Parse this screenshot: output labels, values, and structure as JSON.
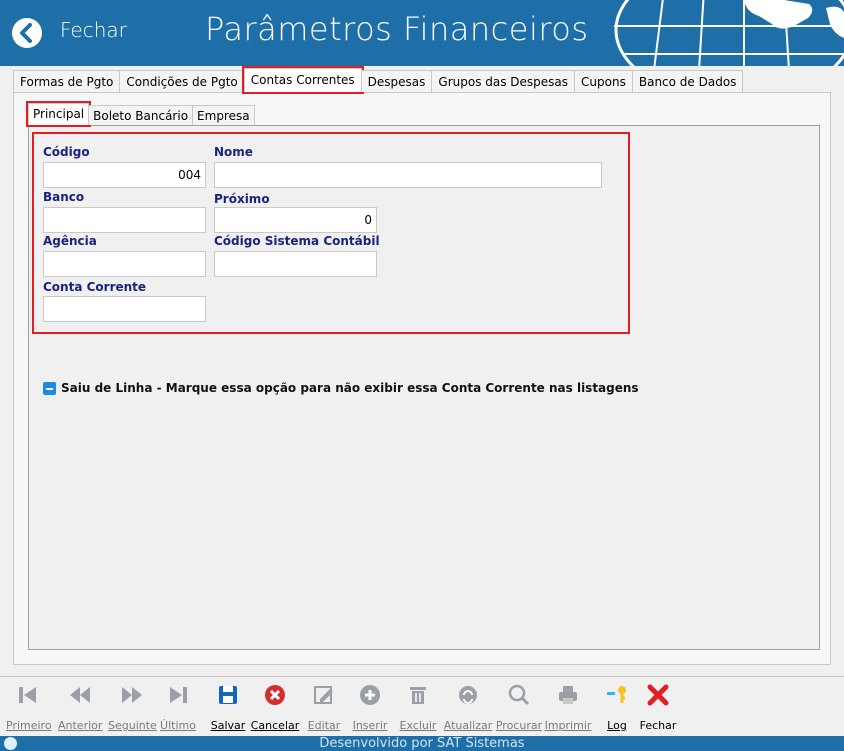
{
  "header": {
    "back_label": "Fechar",
    "title": "Parâmetros Financeiros",
    "accent_color": "#1e6fa8"
  },
  "main_tabs": [
    {
      "label": "Formas de Pgto"
    },
    {
      "label": "Condições de Pgto"
    },
    {
      "label": "Contas Correntes",
      "active": true
    },
    {
      "label": "Despesas"
    },
    {
      "label": "Grupos das Despesas"
    },
    {
      "label": "Cupons"
    },
    {
      "label": "Banco de Dados"
    }
  ],
  "sub_tabs": [
    {
      "label": "Principal",
      "active": true
    },
    {
      "label": "Boleto Bancário"
    },
    {
      "label": "Empresa"
    }
  ],
  "form": {
    "codigo": {
      "label": "Código",
      "value": "004"
    },
    "nome": {
      "label": "Nome",
      "value": ""
    },
    "banco": {
      "label": "Banco",
      "value": ""
    },
    "proximo": {
      "label": "Próximo",
      "value": "0"
    },
    "agencia": {
      "label": "Agência",
      "value": ""
    },
    "codigo_contabil": {
      "label": "Código Sistema Contábil",
      "value": ""
    },
    "conta_corrente": {
      "label": "Conta Corrente",
      "value": ""
    }
  },
  "saiu_de_linha": {
    "label": "Saiu de Linha - Marque essa opção para não exibir essa Conta Corrente nas listagens",
    "state": "indeterminate"
  },
  "toolbar": [
    {
      "label": "Primeiro",
      "icon": "first-record-icon",
      "enabled": false
    },
    {
      "label": "Anterior",
      "icon": "previous-record-icon",
      "enabled": false
    },
    {
      "label": "Seguinte",
      "icon": "next-record-icon",
      "enabled": false
    },
    {
      "label": "Último",
      "icon": "last-record-icon",
      "enabled": false
    },
    {
      "label": "Salvar",
      "icon": "save-icon",
      "enabled": true
    },
    {
      "label": "Cancelar",
      "icon": "cancel-icon",
      "enabled": true
    },
    {
      "label": "Editar",
      "icon": "edit-icon",
      "enabled": false
    },
    {
      "label": "Inserir",
      "icon": "insert-icon",
      "enabled": false
    },
    {
      "label": "Excluir",
      "icon": "delete-icon",
      "enabled": false
    },
    {
      "label": "Atualizar",
      "icon": "refresh-icon",
      "enabled": false
    },
    {
      "label": "Procurar",
      "icon": "search-icon",
      "enabled": false
    },
    {
      "label": "Imprimir",
      "icon": "print-icon",
      "enabled": false
    },
    {
      "label": "Log",
      "icon": "key-icon",
      "enabled": true
    },
    {
      "label": "Fechar",
      "icon": "close-icon",
      "enabled": true
    }
  ],
  "footer": {
    "text": "Desenvolvido por SAT Sistemas"
  },
  "colors": {
    "highlight": "#e21d24",
    "label": "#1a237e",
    "save": "#1565c0",
    "cancel": "#d32f2f"
  }
}
